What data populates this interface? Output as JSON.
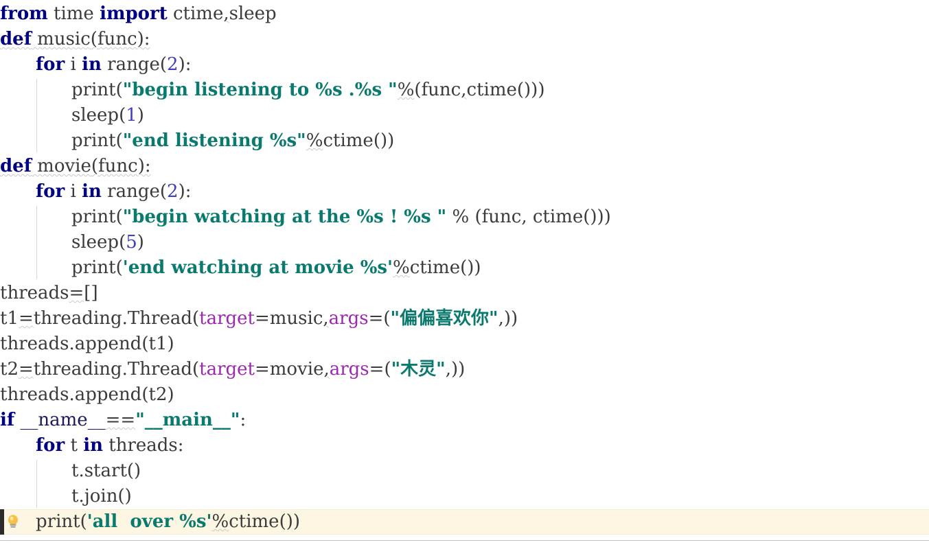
{
  "editor": {
    "language": "Python",
    "font_size_px": 26,
    "line_height_px": 37,
    "background_color": "#ffffff",
    "current_line_highlight_color": "#fdf6e3",
    "caret_color": "#2b2b2b",
    "indent_guide_color": "#d8d8dc",
    "bottom_separator_color": "#c4c4c4"
  },
  "syntax_colors": {
    "keyword": "#000080",
    "string": "#0b7a6e",
    "number": "#3f3fbf",
    "keyword_argument": "#9c27b0",
    "identifier": "#3b3b3b",
    "dunder": "#1a1a5e",
    "weak_warning_underline": "#c9c9cf"
  },
  "gutter": {
    "intention_icon": "lightbulb-icon",
    "intention_icon_color": "#f5c147",
    "intention_icon_base_color": "#9e9e9e"
  },
  "code": {
    "lines": [
      {
        "n": 1,
        "indent": 0,
        "warn": false,
        "tokens": [
          {
            "t": "from",
            "c": "kw"
          },
          {
            "t": " time ",
            "c": "ident"
          },
          {
            "t": "import",
            "c": "kw"
          },
          {
            "t": " ctime",
            "c": "ident"
          },
          {
            "t": ",",
            "c": "punc",
            "wavy": true
          },
          {
            "t": "sleep",
            "c": "ident"
          }
        ]
      },
      {
        "n": 2,
        "indent": 0,
        "warn": true,
        "tokens": [
          {
            "t": "def",
            "c": "kw"
          },
          {
            "t": " music",
            "c": "ident"
          },
          {
            "t": "(",
            "c": "punc"
          },
          {
            "t": "func",
            "c": "ident"
          },
          {
            "t": "):",
            "c": "punc"
          }
        ]
      },
      {
        "n": 3,
        "indent": 1,
        "warn": false,
        "tokens": [
          {
            "t": "for",
            "c": "kw"
          },
          {
            "t": " i ",
            "c": "ident"
          },
          {
            "t": "in",
            "c": "kw"
          },
          {
            "t": " range",
            "c": "ident"
          },
          {
            "t": "(",
            "c": "punc"
          },
          {
            "t": "2",
            "c": "num"
          },
          {
            "t": "):",
            "c": "punc"
          }
        ]
      },
      {
        "n": 4,
        "indent": 2,
        "warn": false,
        "tokens": [
          {
            "t": "print",
            "c": "ident"
          },
          {
            "t": "(",
            "c": "punc"
          },
          {
            "t": "\"begin listening to %s .%s \"",
            "c": "str"
          },
          {
            "t": "%",
            "c": "punc",
            "wavy": true
          },
          {
            "t": "(",
            "c": "punc"
          },
          {
            "t": "func",
            "c": "ident"
          },
          {
            "t": ",",
            "c": "punc",
            "wavy": true
          },
          {
            "t": "ctime",
            "c": "ident"
          },
          {
            "t": "()))",
            "c": "punc"
          }
        ]
      },
      {
        "n": 5,
        "indent": 2,
        "warn": false,
        "tokens": [
          {
            "t": "sleep",
            "c": "ident"
          },
          {
            "t": "(",
            "c": "punc"
          },
          {
            "t": "1",
            "c": "num"
          },
          {
            "t": ")",
            "c": "punc"
          }
        ]
      },
      {
        "n": 6,
        "indent": 2,
        "warn": false,
        "tokens": [
          {
            "t": "print",
            "c": "ident"
          },
          {
            "t": "(",
            "c": "punc"
          },
          {
            "t": "\"end listening %s\"",
            "c": "str"
          },
          {
            "t": "%",
            "c": "punc",
            "wavy": true
          },
          {
            "t": "ctime",
            "c": "ident"
          },
          {
            "t": "())",
            "c": "punc"
          }
        ]
      },
      {
        "n": 7,
        "indent": 0,
        "warn": true,
        "tokens": [
          {
            "t": "def",
            "c": "kw"
          },
          {
            "t": " movie",
            "c": "ident"
          },
          {
            "t": "(",
            "c": "punc"
          },
          {
            "t": "func",
            "c": "ident"
          },
          {
            "t": "):",
            "c": "punc"
          }
        ]
      },
      {
        "n": 8,
        "indent": 1,
        "warn": false,
        "tokens": [
          {
            "t": "for",
            "c": "kw"
          },
          {
            "t": " i ",
            "c": "ident"
          },
          {
            "t": "in",
            "c": "kw"
          },
          {
            "t": " range",
            "c": "ident"
          },
          {
            "t": "(",
            "c": "punc"
          },
          {
            "t": "2",
            "c": "num"
          },
          {
            "t": "):",
            "c": "punc"
          }
        ]
      },
      {
        "n": 9,
        "indent": 2,
        "warn": false,
        "tokens": [
          {
            "t": "print",
            "c": "ident"
          },
          {
            "t": "(",
            "c": "punc"
          },
          {
            "t": "\"begin watching at the %s ! %s \"",
            "c": "str"
          },
          {
            "t": " % (",
            "c": "punc"
          },
          {
            "t": "func",
            "c": "ident"
          },
          {
            "t": ", ",
            "c": "punc"
          },
          {
            "t": "ctime",
            "c": "ident"
          },
          {
            "t": "()))",
            "c": "punc"
          }
        ]
      },
      {
        "n": 10,
        "indent": 2,
        "warn": false,
        "tokens": [
          {
            "t": "sleep",
            "c": "ident"
          },
          {
            "t": "(",
            "c": "punc"
          },
          {
            "t": "5",
            "c": "num"
          },
          {
            "t": ")",
            "c": "punc"
          }
        ]
      },
      {
        "n": 11,
        "indent": 2,
        "warn": false,
        "tokens": [
          {
            "t": "print",
            "c": "ident"
          },
          {
            "t": "(",
            "c": "punc"
          },
          {
            "t": "'end watching at movie %s'",
            "c": "str"
          },
          {
            "t": "%",
            "c": "punc",
            "wavy": true
          },
          {
            "t": "ctime",
            "c": "ident"
          },
          {
            "t": "())",
            "c": "punc"
          }
        ]
      },
      {
        "n": 12,
        "indent": 0,
        "warn": false,
        "tokens": [
          {
            "t": "threads",
            "c": "ident"
          },
          {
            "t": "=",
            "c": "punc",
            "wavy": true
          },
          {
            "t": "[]",
            "c": "punc"
          }
        ]
      },
      {
        "n": 13,
        "indent": 0,
        "warn": false,
        "tokens": [
          {
            "t": "t1",
            "c": "ident"
          },
          {
            "t": "=",
            "c": "punc",
            "wavy": true
          },
          {
            "t": "threading",
            "c": "ident"
          },
          {
            "t": ".",
            "c": "punc"
          },
          {
            "t": "Thread",
            "c": "ident"
          },
          {
            "t": "(",
            "c": "punc"
          },
          {
            "t": "target",
            "c": "kwarg"
          },
          {
            "t": "=music",
            "c": "ident"
          },
          {
            "t": ",",
            "c": "punc",
            "wavy": true
          },
          {
            "t": "args",
            "c": "kwarg"
          },
          {
            "t": "=(",
            "c": "punc"
          },
          {
            "t": "\"偏偏喜欢你\"",
            "c": "str"
          },
          {
            "t": ",))",
            "c": "punc"
          }
        ]
      },
      {
        "n": 14,
        "indent": 0,
        "warn": false,
        "tokens": [
          {
            "t": "threads",
            "c": "ident"
          },
          {
            "t": ".",
            "c": "punc"
          },
          {
            "t": "append",
            "c": "ident"
          },
          {
            "t": "(",
            "c": "punc"
          },
          {
            "t": "t1",
            "c": "ident"
          },
          {
            "t": ")",
            "c": "punc"
          }
        ]
      },
      {
        "n": 15,
        "indent": 0,
        "warn": false,
        "tokens": [
          {
            "t": "t2",
            "c": "ident"
          },
          {
            "t": "=",
            "c": "punc",
            "wavy": true
          },
          {
            "t": "threading",
            "c": "ident"
          },
          {
            "t": ".",
            "c": "punc"
          },
          {
            "t": "Thread",
            "c": "ident"
          },
          {
            "t": "(",
            "c": "punc"
          },
          {
            "t": "target",
            "c": "kwarg"
          },
          {
            "t": "=movie",
            "c": "ident"
          },
          {
            "t": ",",
            "c": "punc",
            "wavy": true
          },
          {
            "t": "args",
            "c": "kwarg"
          },
          {
            "t": "=(",
            "c": "punc"
          },
          {
            "t": "\"木灵\"",
            "c": "str"
          },
          {
            "t": ",))",
            "c": "punc"
          }
        ]
      },
      {
        "n": 16,
        "indent": 0,
        "warn": false,
        "tokens": [
          {
            "t": "threads",
            "c": "ident"
          },
          {
            "t": ".",
            "c": "punc"
          },
          {
            "t": "append",
            "c": "ident"
          },
          {
            "t": "(",
            "c": "punc"
          },
          {
            "t": "t2",
            "c": "ident"
          },
          {
            "t": ")",
            "c": "punc"
          }
        ]
      },
      {
        "n": 17,
        "indent": 0,
        "warn": false,
        "tokens": [
          {
            "t": "if",
            "c": "kw"
          },
          {
            "t": " __name__",
            "c": "dunder"
          },
          {
            "t": "==",
            "c": "punc",
            "wavy": true
          },
          {
            "t": "\"__main__\"",
            "c": "str"
          },
          {
            "t": ":",
            "c": "punc"
          }
        ]
      },
      {
        "n": 18,
        "indent": 1,
        "warn": false,
        "tokens": [
          {
            "t": "for",
            "c": "kw"
          },
          {
            "t": " t ",
            "c": "ident"
          },
          {
            "t": "in",
            "c": "kw"
          },
          {
            "t": " threads:",
            "c": "ident"
          }
        ]
      },
      {
        "n": 19,
        "indent": 2,
        "warn": false,
        "tokens": [
          {
            "t": "t",
            "c": "ident"
          },
          {
            "t": ".",
            "c": "punc"
          },
          {
            "t": "start",
            "c": "ident"
          },
          {
            "t": "()",
            "c": "punc"
          }
        ]
      },
      {
        "n": 20,
        "indent": 2,
        "warn": false,
        "tokens": [
          {
            "t": "t",
            "c": "ident"
          },
          {
            "t": ".",
            "c": "punc"
          },
          {
            "t": "join",
            "c": "ident"
          },
          {
            "t": "()",
            "c": "punc"
          }
        ]
      },
      {
        "n": 21,
        "indent": 1,
        "warn": false,
        "current": true,
        "tokens": [
          {
            "t": "print",
            "c": "ident"
          },
          {
            "t": "(",
            "c": "punc"
          },
          {
            "t": "'all  over %s'",
            "c": "str"
          },
          {
            "t": "%",
            "c": "punc",
            "wavy": true
          },
          {
            "t": "ctime",
            "c": "ident"
          },
          {
            "t": "())",
            "c": "punc"
          }
        ]
      }
    ]
  }
}
